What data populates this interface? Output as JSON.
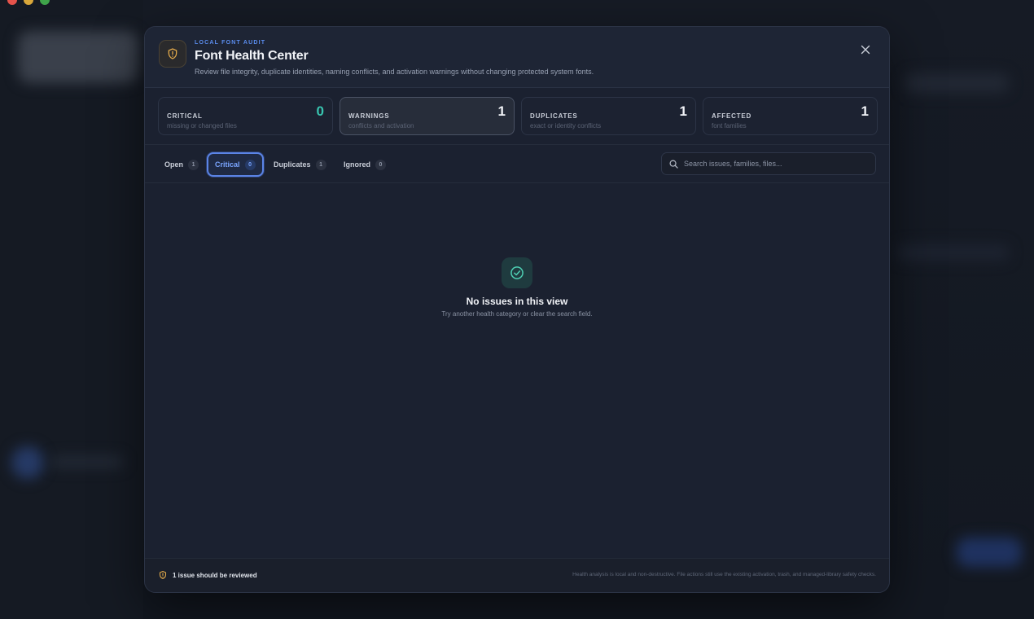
{
  "header": {
    "eyebrow": "LOCAL FONT AUDIT",
    "title": "Font Health Center",
    "subtitle": "Review file integrity, duplicate identities, naming conflicts, and activation warnings without changing protected system fonts.",
    "icon": "shield-alert-icon",
    "close_icon": "close-icon"
  },
  "stats": [
    {
      "label": "CRITICAL",
      "description": "missing or changed files",
      "value": "0",
      "color": "#38c5b0"
    },
    {
      "label": "WARNINGS",
      "description": "conflicts and activation",
      "value": "1",
      "active": true
    },
    {
      "label": "DUPLICATES",
      "description": "exact or identity conflicts",
      "value": "1"
    },
    {
      "label": "AFFECTED",
      "description": "font families",
      "value": "1"
    }
  ],
  "tabs": [
    {
      "label": "Open",
      "count": "1"
    },
    {
      "label": "Critical",
      "count": "0",
      "active": true
    },
    {
      "label": "Duplicates",
      "count": "1"
    },
    {
      "label": "Ignored",
      "count": "0"
    }
  ],
  "search": {
    "placeholder": "Search issues, families, files...",
    "value": "",
    "icon": "search-icon"
  },
  "empty_state": {
    "icon": "check-circle-icon",
    "title": "No issues in this view",
    "description": "Try another health category or clear the search field."
  },
  "footer": {
    "status_icon": "shield-alert-icon",
    "status_text": "1 issue should be reviewed",
    "note": "Health analysis is local and non-destructive. File actions still use the existing activation, trash, and managed-library safety checks."
  },
  "colors": {
    "accent": "#5b84e6",
    "teal": "#38c5b0",
    "warning": "#e0a84a"
  }
}
